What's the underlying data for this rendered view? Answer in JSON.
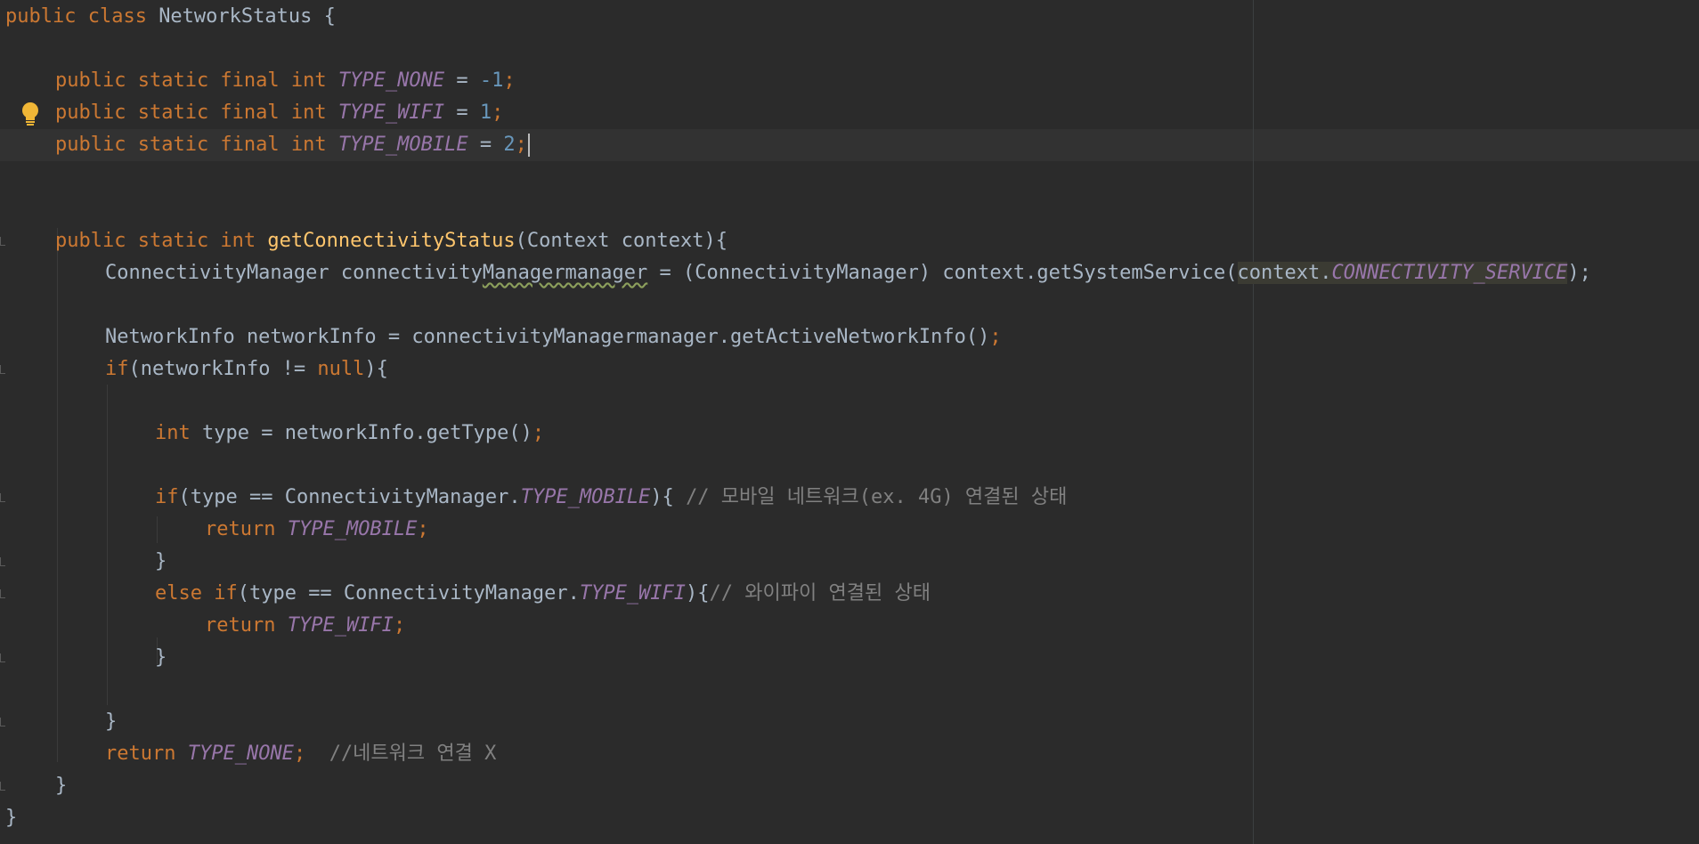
{
  "editor": {
    "language": "java",
    "colors": {
      "background": "#2b2b2b",
      "keyword": "#cc7832",
      "text": "#a9b7c6",
      "constant": "#9876aa",
      "number": "#6897bb",
      "method_declaration": "#ffc66d",
      "comment": "#808080",
      "current_line": "#323232"
    },
    "gutter": {
      "intention_icon": "lightbulb-icon",
      "intention_color": "#f0b636"
    },
    "code": {
      "l1": {
        "a": "public class ",
        "b": "NetworkStatus {"
      },
      "l3": {
        "a": "public static final int ",
        "b": "TYPE_NONE",
        "c": " = ",
        "d": "-1",
        "e": ";"
      },
      "l4": {
        "a": "public static final int ",
        "b": "TYPE_WIFI",
        "c": " = ",
        "d": "1",
        "e": ";"
      },
      "l5": {
        "a": "public static final int ",
        "b": "TYPE_MOBILE",
        "c": " = ",
        "d": "2",
        "e": ";"
      },
      "l8": {
        "a": "public static int ",
        "b": "getConnectivityStatus",
        "c": "(Context context){"
      },
      "l9": {
        "a": "ConnectivityManager connectivity",
        "b": "Managermanager",
        "c": " = (ConnectivityManager) context.getSystemService(",
        "d": "context.",
        "e": "CONNECTIVITY_SERVICE",
        "f": ");"
      },
      "l11": {
        "a": "NetworkInfo networkInfo = connectivityManagermanager.getActiveNetworkInfo()",
        "b": ";"
      },
      "l12": {
        "a": "if",
        "b": "(networkInfo != ",
        "c": "null",
        "d": "){"
      },
      "l14": {
        "a": "int ",
        "b": "type = networkInfo.getType()",
        "c": ";"
      },
      "l16": {
        "a": "if",
        "b": "(type == ConnectivityManager.",
        "c": "TYPE_MOBILE",
        "d": "){ ",
        "e": "// 모바일 네트워크(ex. 4G) 연결된 상태"
      },
      "l17": {
        "a": "return ",
        "b": "TYPE_MOBILE",
        "c": ";"
      },
      "l18": {
        "a": "}"
      },
      "l19": {
        "a": "else if",
        "b": "(type == ConnectivityManager.",
        "c": "TYPE_WIFI",
        "d": "){",
        "e": "// 와이파이 연결된 상태"
      },
      "l20": {
        "a": "return ",
        "b": "TYPE_WIFI",
        "c": ";"
      },
      "l21": {
        "a": "}"
      },
      "l23": {
        "a": "}"
      },
      "l24": {
        "a": "return ",
        "b": "TYPE_NONE",
        "c": ";  ",
        "d": "//네트워크 연결 X"
      },
      "l25": {
        "a": "}"
      },
      "l26": {
        "a": "}"
      }
    }
  }
}
